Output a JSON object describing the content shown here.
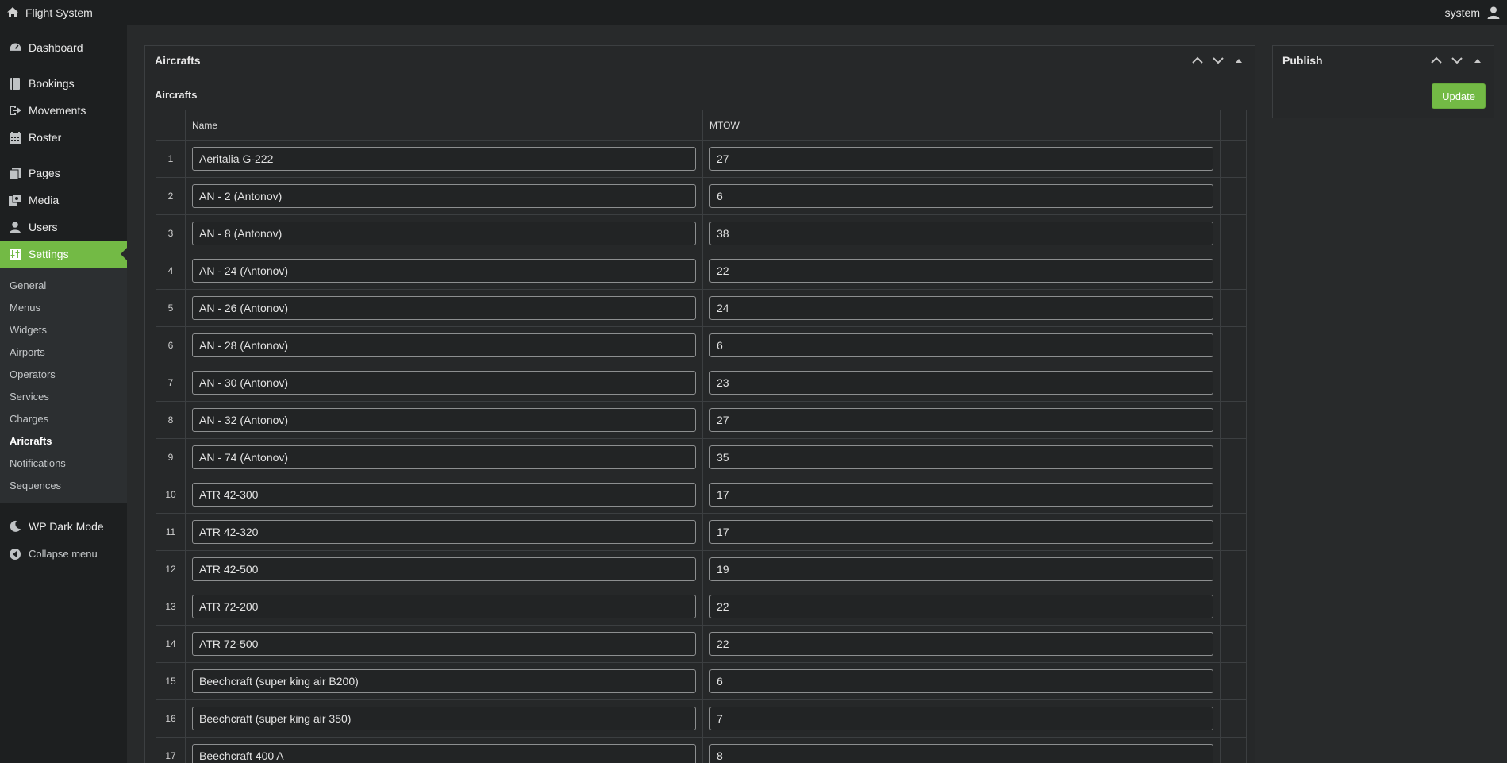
{
  "topbar": {
    "site_name": "Flight System",
    "user": "system"
  },
  "sidebar": {
    "groups": [
      [
        {
          "label": "Dashboard",
          "icon": "dashboard-icon"
        }
      ],
      [
        {
          "label": "Bookings",
          "icon": "book-icon"
        },
        {
          "label": "Movements",
          "icon": "exit-icon"
        },
        {
          "label": "Roster",
          "icon": "calendar-icon"
        }
      ],
      [
        {
          "label": "Pages",
          "icon": "pages-icon"
        },
        {
          "label": "Media",
          "icon": "media-icon"
        },
        {
          "label": "Users",
          "icon": "user-icon"
        },
        {
          "label": "Settings",
          "icon": "settings-icon",
          "active": true
        }
      ]
    ],
    "submenu": [
      "General",
      "Menus",
      "Widgets",
      "Airports",
      "Operators",
      "Services",
      "Charges",
      "Aricrafts",
      "Notifications",
      "Sequences"
    ],
    "submenu_current": "Aricrafts",
    "dark_mode": "WP Dark Mode",
    "collapse": "Collapse menu"
  },
  "main": {
    "box_title": "Aircrafts",
    "section_title": "Aircrafts",
    "columns": [
      "Name",
      "MTOW"
    ],
    "rows": [
      {
        "n": "1",
        "name": "Aeritalia G-222",
        "mtow": "27"
      },
      {
        "n": "2",
        "name": "AN - 2 (Antonov)",
        "mtow": "6"
      },
      {
        "n": "3",
        "name": "AN - 8 (Antonov)",
        "mtow": "38"
      },
      {
        "n": "4",
        "name": "AN - 24 (Antonov)",
        "mtow": "22"
      },
      {
        "n": "5",
        "name": "AN - 26 (Antonov)",
        "mtow": "24"
      },
      {
        "n": "6",
        "name": "AN - 28 (Antonov)",
        "mtow": "6"
      },
      {
        "n": "7",
        "name": "AN - 30 (Antonov)",
        "mtow": "23"
      },
      {
        "n": "8",
        "name": "AN - 32 (Antonov)",
        "mtow": "27"
      },
      {
        "n": "9",
        "name": "AN - 74 (Antonov)",
        "mtow": "35"
      },
      {
        "n": "10",
        "name": "ATR 42-300",
        "mtow": "17"
      },
      {
        "n": "11",
        "name": "ATR 42-320",
        "mtow": "17"
      },
      {
        "n": "12",
        "name": "ATR 42-500",
        "mtow": "19"
      },
      {
        "n": "13",
        "name": "ATR 72-200",
        "mtow": "22"
      },
      {
        "n": "14",
        "name": "ATR 72-500",
        "mtow": "22"
      },
      {
        "n": "15",
        "name": "Beechcraft (super king air B200)",
        "mtow": "6"
      },
      {
        "n": "16",
        "name": "Beechcraft (super king air 350)",
        "mtow": "7"
      },
      {
        "n": "17",
        "name": "Beechcraft 400 A",
        "mtow": "8"
      }
    ]
  },
  "publish": {
    "title": "Publish",
    "update_label": "Update"
  },
  "colors": {
    "accent": "#73ba45",
    "bar": "#1d1f20",
    "background": "#282a2b"
  }
}
